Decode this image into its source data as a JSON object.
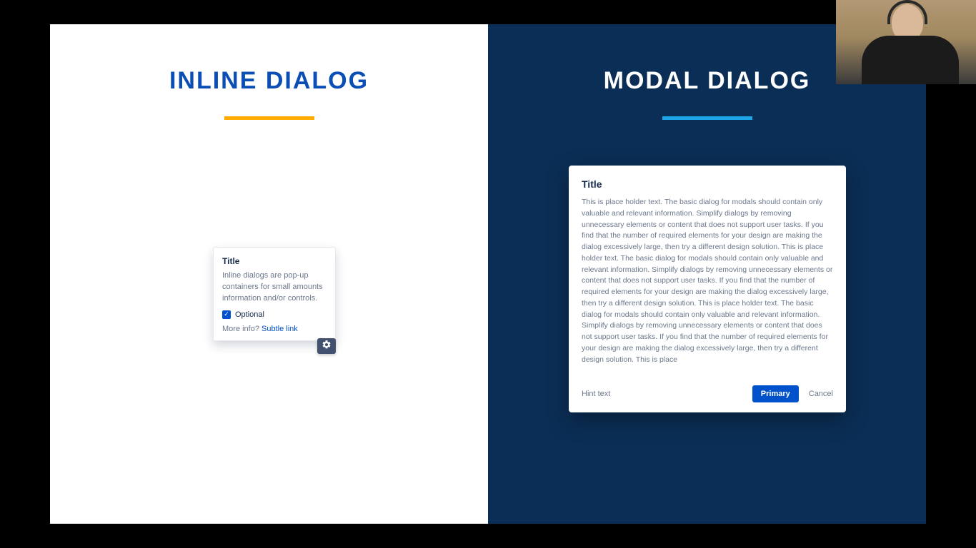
{
  "left": {
    "heading": "INLINE DIALOG",
    "dialog": {
      "title": "Title",
      "body": "Inline dialogs are pop-up containers for small amounts information and/or controls.",
      "checkbox_label": "Optional",
      "footer_prefix": "More info?",
      "footer_link": "Subtle link"
    }
  },
  "right": {
    "heading": "MODAL DIALOG",
    "dialog": {
      "title": "Title",
      "body": "This is place holder text. The basic dialog for modals should contain only valuable and relevant information. Simplify dialogs by removing unnecessary elements or content that does not support user tasks. If you find that the number of required elements for your design are making the dialog excessively large, then try a different design solution. This is place holder text. The basic dialog for modals should contain only valuable and relevant information. Simplify dialogs by removing unnecessary elements or content that does not support user tasks. If you find that the number of required elements for your design are making the dialog excessively large, then try a different design solution. This is place holder text. The basic dialog for modals should contain only valuable and relevant information. Simplify dialogs by removing unnecessary elements or content that does not support user tasks. If you find that the number of required elements for your design are making the dialog excessively large, then try a different design solution. This is place",
      "hint": "Hint text",
      "primary_label": "Primary",
      "cancel_label": "Cancel"
    }
  },
  "colors": {
    "brand_blue": "#0b4eb5",
    "navy_bg": "#0b2e56",
    "accent_orange": "#ffab00",
    "accent_cyan": "#1ea5e8",
    "primary_button": "#0052cc"
  }
}
